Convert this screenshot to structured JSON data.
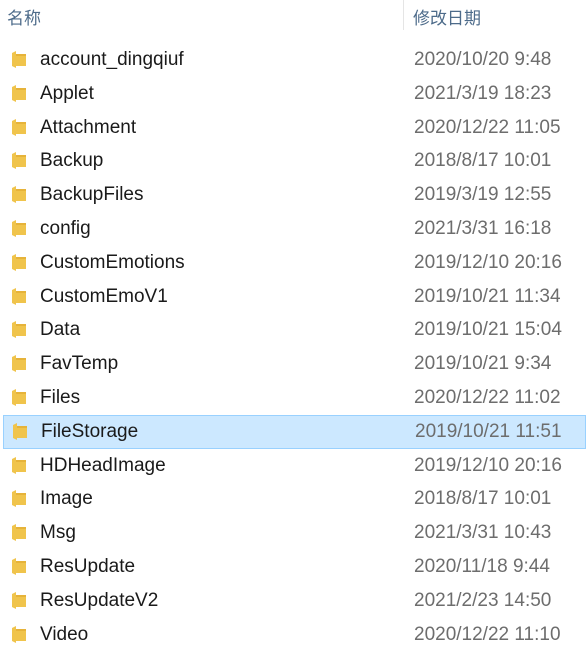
{
  "columns": {
    "name": "名称",
    "modified": "修改日期"
  },
  "colors": {
    "folder": "#f0c44c",
    "selected_bg": "#cce8ff",
    "selected_border": "#99d1ff",
    "header_text": "#4d6b8a"
  },
  "icons": {
    "folder": "folder-icon"
  },
  "files": [
    {
      "name": "account_dingqiuf",
      "modified": "2020/10/20 9:48",
      "selected": false
    },
    {
      "name": "Applet",
      "modified": "2021/3/19 18:23",
      "selected": false
    },
    {
      "name": "Attachment",
      "modified": "2020/12/22 11:05",
      "selected": false
    },
    {
      "name": "Backup",
      "modified": "2018/8/17 10:01",
      "selected": false
    },
    {
      "name": "BackupFiles",
      "modified": "2019/3/19 12:55",
      "selected": false
    },
    {
      "name": "config",
      "modified": "2021/3/31 16:18",
      "selected": false
    },
    {
      "name": "CustomEmotions",
      "modified": "2019/12/10 20:16",
      "selected": false
    },
    {
      "name": "CustomEmoV1",
      "modified": "2019/10/21 11:34",
      "selected": false
    },
    {
      "name": "Data",
      "modified": "2019/10/21 15:04",
      "selected": false
    },
    {
      "name": "FavTemp",
      "modified": "2019/10/21 9:34",
      "selected": false
    },
    {
      "name": "Files",
      "modified": "2020/12/22 11:02",
      "selected": false
    },
    {
      "name": "FileStorage",
      "modified": "2019/10/21 11:51",
      "selected": true
    },
    {
      "name": "HDHeadImage",
      "modified": "2019/12/10 20:16",
      "selected": false
    },
    {
      "name": "Image",
      "modified": "2018/8/17 10:01",
      "selected": false
    },
    {
      "name": "Msg",
      "modified": "2021/3/31 10:43",
      "selected": false
    },
    {
      "name": "ResUpdate",
      "modified": "2020/11/18 9:44",
      "selected": false
    },
    {
      "name": "ResUpdateV2",
      "modified": "2021/2/23 14:50",
      "selected": false
    },
    {
      "name": "Video",
      "modified": "2020/12/22 11:10",
      "selected": false
    }
  ]
}
